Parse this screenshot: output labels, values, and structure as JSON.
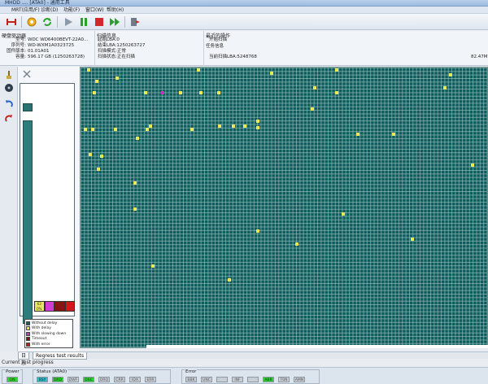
{
  "window": {
    "title": "MHDD .... [ATA0] - 通用工具"
  },
  "menu": [
    "MRT(应用/F)",
    "诊断(D)",
    "功能(F)",
    "窗口(W)",
    "帮助(H)"
  ],
  "toolbar": {
    "icons": [
      "disconnect-icon",
      "settings-icon",
      "refresh-icon",
      "play-icon",
      "pause-icon",
      "stop-icon",
      "skip-icon",
      "exit-icon"
    ]
  },
  "drive_info": {
    "title": "硬盘驱动器",
    "rows": [
      {
        "label": "型号:",
        "value": "WDC WD6400BEVT-22A0..."
      },
      {
        "label": "序列号:",
        "value": "WD-WXM1A0323725"
      },
      {
        "label": "固件版本:",
        "value": "01.01A01"
      },
      {
        "label": "容量:",
        "value": "596.17 GB (1250263728)"
      }
    ]
  },
  "scan_info": {
    "title": "扫描信息",
    "rows": [
      "起始LBA:0",
      "结束LBA:1250263727",
      "扫描模式:正常",
      "扫描状态:正在扫描"
    ]
  },
  "recent_ops": {
    "title": "最近的操作",
    "item": "开始扫描",
    "task_title": "任务信息",
    "current_lba": "当前扫描LBA:5248768",
    "percent": "82.47M"
  },
  "left_tools": [
    "brush-icon",
    "disk-icon",
    "undo-icon",
    "redo-icon"
  ],
  "block_palette": {
    "swatch_labels": [
      "63\n0%",
      "",
      "",
      ""
    ],
    "colors": [
      "#e8e85a",
      "#d43cd4",
      "#8a1414",
      "#d21818"
    ]
  },
  "legend": [
    {
      "label": "Without delay",
      "color": "#175e5e"
    },
    {
      "label": "With delay",
      "color": "#e6e25a"
    },
    {
      "label": "With slowing down",
      "color": "#b53cb5"
    },
    {
      "label": "Timeout",
      "color": "#7a1010"
    },
    {
      "label": "With error",
      "color": "#c71515"
    }
  ],
  "grid": {
    "base_color": "#0f5c5c",
    "blocks": [
      {
        "c": 105,
        "r": 0,
        "color": "#e8e85a"
      },
      {
        "c": 240,
        "r": 0,
        "color": "#e8e85a"
      },
      {
        "c": 140,
        "r": 10,
        "color": "#e8e85a"
      },
      {
        "c": 115,
        "r": 14,
        "color": "#e8e85a"
      },
      {
        "c": 330,
        "r": 4,
        "color": "#e8e85a"
      },
      {
        "c": 410,
        "r": 0,
        "color": "#e8e85a"
      },
      {
        "c": 550,
        "r": 6,
        "color": "#e8e85a"
      },
      {
        "c": 543,
        "r": 22,
        "color": "#e8e85a"
      },
      {
        "c": 112,
        "r": 28,
        "color": "#e8e85a"
      },
      {
        "c": 175,
        "r": 28,
        "color": "#e8e85a"
      },
      {
        "c": 218,
        "r": 28,
        "color": "#e8e85a"
      },
      {
        "c": 243,
        "r": 28,
        "color": "#e8e85a"
      },
      {
        "c": 265,
        "r": 28,
        "color": "#e8e85a"
      },
      {
        "c": 196,
        "r": 28,
        "color": "#b53cb5"
      },
      {
        "c": 410,
        "r": 28,
        "color": "#e8e85a"
      },
      {
        "c": 383,
        "r": 22,
        "color": "#e8e85a"
      },
      {
        "c": 380,
        "r": 48,
        "color": "#e8e85a"
      },
      {
        "c": 313,
        "r": 63,
        "color": "#e8e85a"
      },
      {
        "c": 297,
        "r": 69,
        "color": "#e8e85a"
      },
      {
        "c": 283,
        "r": 69,
        "color": "#e8e85a"
      },
      {
        "c": 266,
        "r": 69,
        "color": "#e8e85a"
      },
      {
        "c": 313,
        "r": 71,
        "color": "#e8e85a"
      },
      {
        "c": 101,
        "r": 73,
        "color": "#e8e85a"
      },
      {
        "c": 110,
        "r": 73,
        "color": "#e8e85a"
      },
      {
        "c": 138,
        "r": 73,
        "color": "#e8e85a"
      },
      {
        "c": 177,
        "r": 73,
        "color": "#e8e85a"
      },
      {
        "c": 181,
        "r": 69,
        "color": "#e8e85a"
      },
      {
        "c": 232,
        "r": 73,
        "color": "#e8e85a"
      },
      {
        "c": 165,
        "r": 84,
        "color": "#e8e85a"
      },
      {
        "c": 436,
        "r": 79,
        "color": "#e8e85a"
      },
      {
        "c": 480,
        "r": 79,
        "color": "#e8e85a"
      },
      {
        "c": 107,
        "r": 104,
        "color": "#e8e85a"
      },
      {
        "c": 121,
        "r": 106,
        "color": "#e8e85a"
      },
      {
        "c": 117,
        "r": 122,
        "color": "#e8e85a"
      },
      {
        "c": 577,
        "r": 117,
        "color": "#e8e85a"
      },
      {
        "c": 162,
        "r": 139,
        "color": "#e8e85a"
      },
      {
        "c": 162,
        "r": 171,
        "color": "#e8e85a"
      },
      {
        "c": 418,
        "r": 177,
        "color": "#e8e85a"
      },
      {
        "c": 313,
        "r": 198,
        "color": "#e8e85a"
      },
      {
        "c": 503,
        "r": 208,
        "color": "#e8e85a"
      },
      {
        "c": 361,
        "r": 214,
        "color": "#e8e85a"
      },
      {
        "c": 184,
        "r": 241,
        "color": "#e8e85a"
      },
      {
        "c": 278,
        "r": 258,
        "color": "#e8e85a"
      }
    ]
  },
  "tabs": [
    "日志",
    "Regress test results"
  ],
  "progress_label": "Current test progress",
  "status": {
    "power": {
      "title": "Power",
      "lamps": [
        "ON"
      ]
    },
    "ata": {
      "title": "Status (ATA0)",
      "lamps": [
        "BSY",
        "DRD",
        "DWF",
        "DSC",
        "DRQ",
        "CRR",
        "IDX",
        "ERR"
      ],
      "on": [
        "DRD",
        "DSC"
      ],
      "blue": [
        "BSY"
      ]
    },
    "error": {
      "title": "Error",
      "lamps": [
        "BBK",
        "UNC",
        "",
        "INF",
        "",
        "ABR",
        "T0N",
        "AMN"
      ],
      "on": [
        "ABR"
      ],
      "blue": []
    }
  }
}
